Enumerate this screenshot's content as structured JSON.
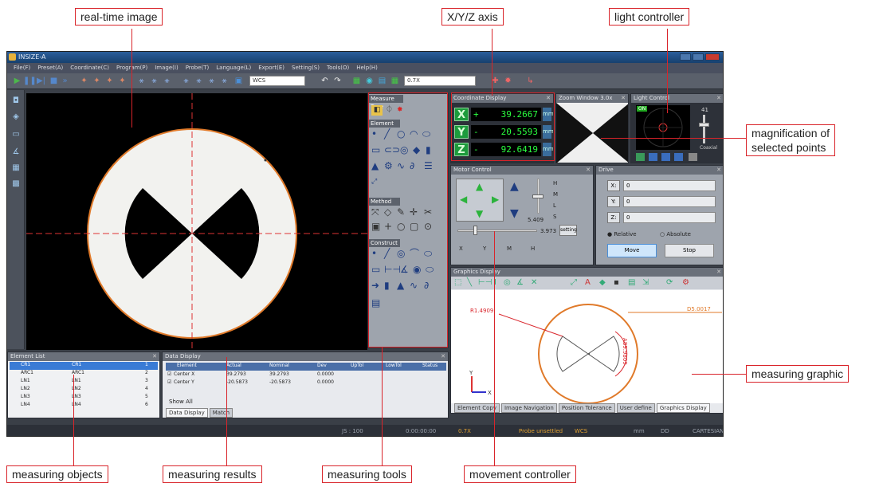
{
  "callouts": {
    "real_time_image": "real-time image",
    "xyz_axis": "X/Y/Z axis",
    "light_controller": "light controller",
    "magnification": "magnification of\nselected points",
    "measuring_graphic": "measuring graphic",
    "measuring_objects": "measuring objects",
    "measuring_results": "measuring results",
    "measuring_tools": "measuring tools",
    "movement_controller": "movement controller"
  },
  "window": {
    "title": "INSIZE-A",
    "menu": [
      "File(F)",
      "Preset(A)",
      "Coordinate(C)",
      "Program(P)",
      "Image(I)",
      "Probe(T)",
      "Language(L)",
      "Export(E)",
      "Setting(S)",
      "Tools(O)",
      "Help(H)"
    ],
    "coordinate_system": "WCS",
    "zoom_select": "0.7X"
  },
  "tools_panel": {
    "title": "Measure Type",
    "sections": [
      "Element",
      "Method",
      "Construct"
    ]
  },
  "coordinate_display": {
    "title": "Coordinate Display",
    "rows": [
      {
        "axis": "X",
        "sign": "+",
        "value": "39.2667",
        "unit": "mm"
      },
      {
        "axis": "Y",
        "sign": "-",
        "value": "20.5593",
        "unit": "mm"
      },
      {
        "axis": "Z",
        "sign": "-",
        "value": "92.6419",
        "unit": "mm"
      }
    ]
  },
  "zoom_window": {
    "title": "Zoom Window 3.0x"
  },
  "light_control": {
    "title": "Light Control",
    "level": "41",
    "badge": "ON",
    "option": "Coaxial"
  },
  "motion_control": {
    "title": "Motor Control",
    "options": [
      "H",
      "M",
      "L",
      "S"
    ],
    "speed_value": "3.973",
    "step": "5.409",
    "setting_label": "setting",
    "axis_checks": [
      "X",
      "Y",
      "M",
      "H"
    ]
  },
  "drive": {
    "title": "Drive",
    "fields": [
      {
        "label": "X:",
        "value": "0"
      },
      {
        "label": "Y:",
        "value": "0"
      },
      {
        "label": "Z:",
        "value": "0"
      }
    ],
    "mode_relative": "Relative",
    "mode_absolute": "Absolute",
    "move_label": "Move",
    "stop_label": "Stop"
  },
  "graphics": {
    "title": "Graphics Display",
    "radius_label": "R1.4909",
    "diameter_label": "D5.0017",
    "angle_label": "A89.9809",
    "axis_y": "Y",
    "axis_x": "X",
    "tabs": [
      "Element Copy",
      "Image Navigation",
      "Position Tolerance",
      "User define",
      "Graphics Display"
    ]
  },
  "element_list": {
    "title": "Element List",
    "rows": [
      {
        "name": "CR1",
        "alias": "CR1",
        "idx": "1"
      },
      {
        "name": "ARC1",
        "alias": "ARC1",
        "idx": "2"
      },
      {
        "name": "LN1",
        "alias": "LN1",
        "idx": "3"
      },
      {
        "name": "LN2",
        "alias": "LN2",
        "idx": "4"
      },
      {
        "name": "LN3",
        "alias": "LN3",
        "idx": "5"
      },
      {
        "name": "LN4",
        "alias": "LN4",
        "idx": "6"
      }
    ]
  },
  "data_display": {
    "title": "Data Display",
    "columns": [
      "Element",
      "Actual",
      "Nominal",
      "Dev",
      "UpTol",
      "LowTol",
      "Status"
    ],
    "rows": [
      {
        "element": "Center X",
        "actual": "39.2793",
        "nominal": "39.2793",
        "dev": "0.0000"
      },
      {
        "element": "Center Y",
        "actual": "-20.5873",
        "nominal": "-20.5873",
        "dev": "0.0000"
      }
    ],
    "show_all": "Show All",
    "tabs": [
      "Data Display",
      "Match"
    ]
  },
  "status_bar": {
    "js": "JS : 100",
    "time": "0:00:00:00",
    "zoom": "0.7X",
    "probe": "Probe unsettled",
    "cs": "WCS",
    "unit": "mm",
    "angle": "DD",
    "mode": "CARTESIAN"
  },
  "colors": {
    "callout_border": "#d9242a",
    "coord_green": "#2aff3f",
    "orange": "#e07a2a",
    "window_bg": "#3a3f47"
  }
}
